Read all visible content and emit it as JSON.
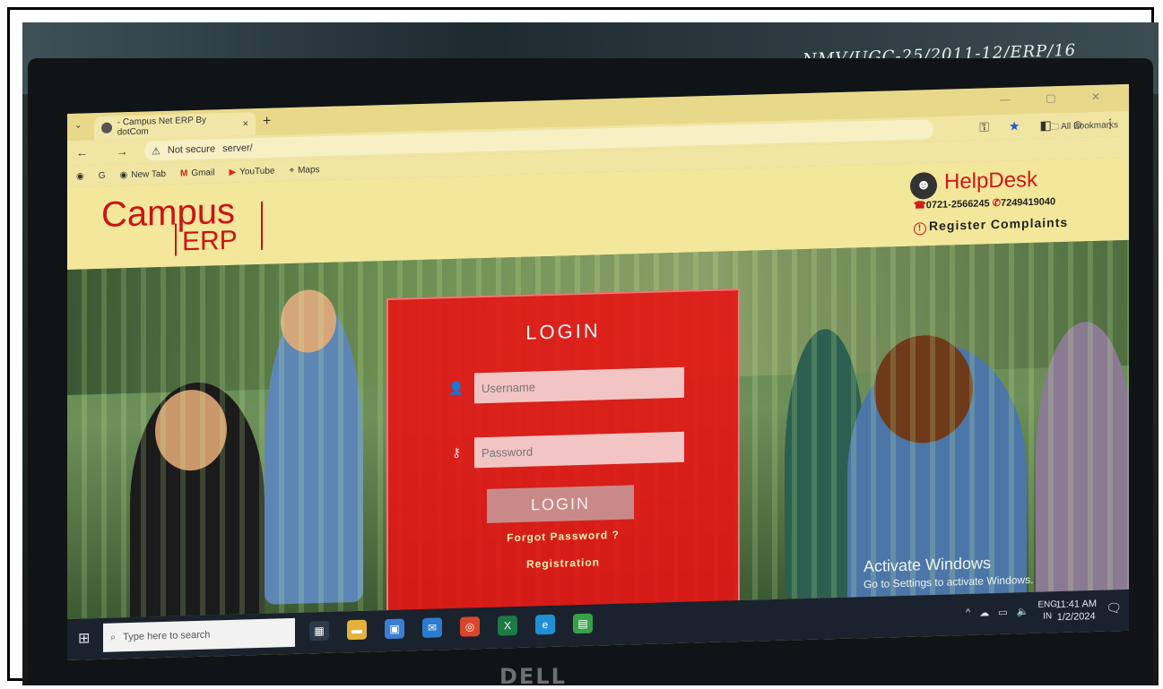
{
  "annotation": "NMV/UGC-25/2011-12/ERP/16",
  "brand": "DELL",
  "browser": {
    "tab_title": "- Campus Net ERP By dotCom",
    "tab_close": "×",
    "new_tab": "+",
    "window_controls": "— ▢ ✕",
    "nav": "← → C",
    "security_label": "Not secure",
    "url": "server/",
    "bookmarks": [
      "New Tab",
      "Gmail",
      "YouTube",
      "Maps"
    ],
    "all_bookmarks": "All Bookmarks"
  },
  "site": {
    "logo_campus": "Campus",
    "logo_erp": "ERP",
    "helpdesk_title": "HelpDesk",
    "phone_1": "0721-2566245",
    "phone_2": "7249419040",
    "register_complaints": "Register Complaints"
  },
  "login": {
    "title": "LOGIN",
    "username_placeholder": "Username",
    "password_placeholder": "Password",
    "button": "LOGIN",
    "forgot": "Forgot Password ?",
    "registration": "Registration"
  },
  "watermark": {
    "line1": "Activate Windows",
    "line2": "Go to Settings to activate Windows."
  },
  "taskbar": {
    "search_placeholder": "Type here to search",
    "lang_top": "ENG",
    "lang_bottom": "IN",
    "time": "11:41 AM",
    "date": "1/2/2024"
  }
}
